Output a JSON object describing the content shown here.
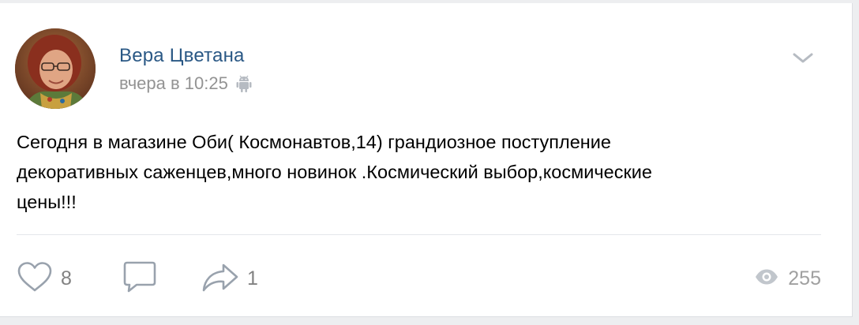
{
  "post": {
    "author": "Вера Цветана",
    "timestamp": "вчера в 10:25",
    "platform_icon": "android-icon",
    "text": "Сегодня в магазине Оби( Космонавтов,14) грандиозное поступление\nдекоративных саженцев,много новинок .Космический выбор,космические\nцены!!!"
  },
  "actions": {
    "likes": "8",
    "comments": "",
    "shares": "1",
    "views": "255"
  },
  "icons": {
    "like": "heart-icon",
    "comment": "comment-bubble-icon",
    "share": "share-arrow-icon",
    "views": "eye-icon",
    "menu": "chevron-down-icon"
  },
  "colors": {
    "author": "#2a5885",
    "meta": "#939393",
    "icon": "#99a2ad",
    "text": "#000000",
    "background": "#edeef0"
  }
}
